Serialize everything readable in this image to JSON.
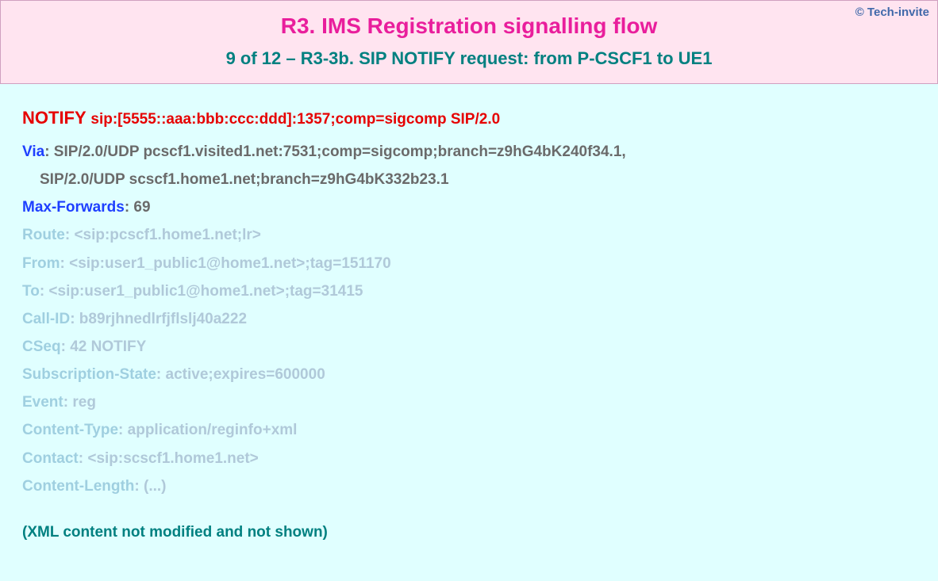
{
  "copyright": "© Tech-invite",
  "title": "R3. IMS Registration signalling flow",
  "subtitle": "9 of 12 – R3-3b. SIP NOTIFY request: from P-CSCF1 to UE1",
  "request": {
    "method": "NOTIFY",
    "uri": "sip:[5555::aaa:bbb:ccc:ddd]:1357;comp=sigcomp SIP/2.0"
  },
  "headers": {
    "via": {
      "name": "Via",
      "line1": "SIP/2.0/UDP pcscf1.visited1.net:7531;comp=sigcomp;branch=z9hG4bK240f34.1,",
      "line2": "SIP/2.0/UDP scscf1.home1.net;branch=z9hG4bK332b23.1"
    },
    "maxForwards": {
      "name": "Max-Forwards",
      "value": "69"
    },
    "route": {
      "name": "Route",
      "value": "<sip:pcscf1.home1.net;lr>"
    },
    "from": {
      "name": "From",
      "value": "<sip:user1_public1@home1.net>;tag=151170"
    },
    "to": {
      "name": "To",
      "value": "<sip:user1_public1@home1.net>;tag=31415"
    },
    "callId": {
      "name": "Call-ID",
      "value": "b89rjhnedlrfjflslj40a222"
    },
    "cseq": {
      "name": "CSeq",
      "value": "42 NOTIFY"
    },
    "subState": {
      "name": "Subscription-State",
      "value": "active;expires=600000"
    },
    "event": {
      "name": "Event",
      "value": "reg"
    },
    "contentType": {
      "name": "Content-Type",
      "value": "application/reginfo+xml"
    },
    "contact": {
      "name": "Contact",
      "value": "<sip:scscf1.home1.net>"
    },
    "contentLength": {
      "name": "Content-Length",
      "value": "(...)"
    }
  },
  "xmlNote": "(XML content not modified and not shown)"
}
